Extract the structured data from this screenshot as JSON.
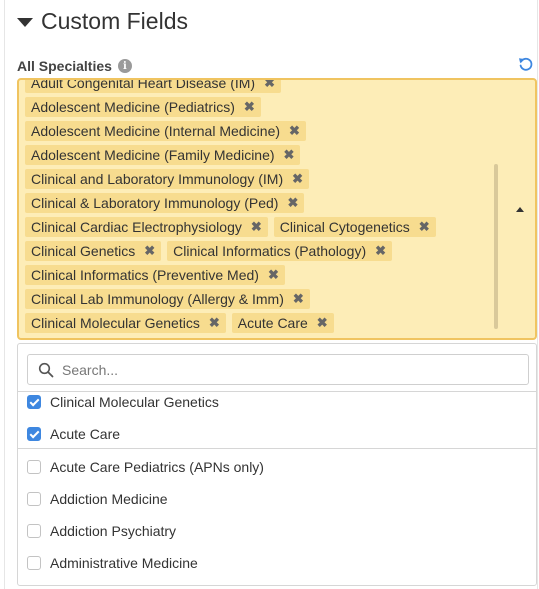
{
  "section": {
    "title": "Custom Fields"
  },
  "field": {
    "label": "All Specialties",
    "info_glyph": "i"
  },
  "selected_chips": [
    "Adult Congenital Heart Disease (IM)",
    "Adolescent Medicine (Pediatrics)",
    "Adolescent Medicine (Internal Medicine)",
    "Adolescent Medicine (Family Medicine)",
    "Clinical and Laboratory Immunology (IM)",
    "Clinical & Laboratory Immunology (Ped)",
    "Clinical Cardiac Electrophysiology",
    "Clinical Cytogenetics",
    "Clinical Genetics",
    "Clinical Informatics (Pathology)",
    "Clinical Informatics (Preventive Med)",
    "Clinical Lab Immunology (Allergy & Imm)",
    "Clinical Molecular Genetics",
    "Acute Care"
  ],
  "chip_remove_glyph": "✖",
  "search": {
    "placeholder": "Search...",
    "value": ""
  },
  "options": [
    {
      "label": "Clinical Molecular Genetics",
      "checked": true
    },
    {
      "label": "Acute Care",
      "checked": true
    },
    {
      "label": "Acute Care Pediatrics (APNs only)",
      "checked": false
    },
    {
      "label": "Addiction Medicine",
      "checked": false
    },
    {
      "label": "Addiction Psychiatry",
      "checked": false
    },
    {
      "label": "Administrative Medicine",
      "checked": false
    }
  ],
  "colors": {
    "accent": "#3e87e0",
    "select_bg": "#fdedb7",
    "chip_bg": "#f7dc8f",
    "select_border": "#f0c460"
  },
  "icons": [
    "caret-down-icon",
    "info-icon",
    "reset-icon",
    "chip-remove-icon",
    "caret-up-icon",
    "search-icon",
    "checkbox-icon"
  ]
}
